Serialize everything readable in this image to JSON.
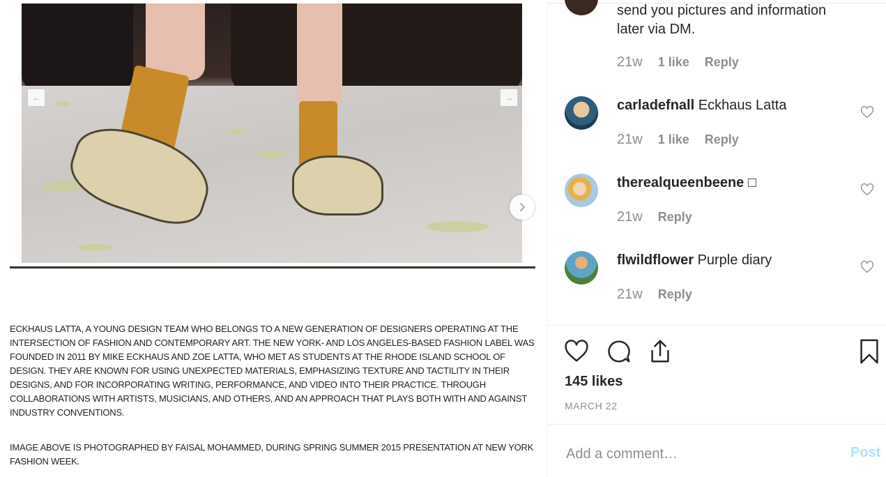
{
  "post": {
    "caption_paragraph_1": "ECKHAUS LATTA, A YOUNG DESIGN TEAM WHO BELONGS TO A NEW GENERATION OF DESIGNERS OPERATING AT THE INTERSECTION OF FASHION AND CONTEMPORARY ART. THE NEW YORK- AND LOS ANGELES-BASED FASHION LABEL WAS FOUNDED IN 2011 BY MIKE ECKHAUS AND ZOE LATTA, WHO MET AS STUDENTS AT THE RHODE ISLAND SCHOOL OF DESIGN. THEY ARE KNOWN FOR USING UNEXPECTED MATERIALS, EMPHASIZING TEXTURE AND TACTILITY IN THEIR DESIGNS, AND FOR INCORPORATING WRITING, PERFORMANCE, AND VIDEO INTO THEIR PRACTICE. THROUGH COLLABORATIONS WITH ARTISTS, MUSICIANS, AND OTHERS, AND AN APPROACH THAT PLAYS BOTH WITH AND AGAINST INDUSTRY CONVENTIONS.",
    "caption_paragraph_2": "IMAGE ABOVE IS PHOTOGRAPHED BY FAISAL MOHAMMED, DURING SPRING SUMMER 2015 PRESENTATION AT NEW YORK FASHION WEEK.",
    "inner_prev_arrow": "←",
    "inner_next_arrow": "→"
  },
  "comments": [
    {
      "user": "",
      "text": "send you pictures and information later via DM.",
      "time": "21w",
      "likes": "1 like",
      "reply": "Reply"
    },
    {
      "user": "carladefnall",
      "text": "Eckhaus Latta",
      "time": "21w",
      "likes": "1 like",
      "reply": "Reply"
    },
    {
      "user": "therealqueenbeene",
      "text": "□",
      "time": "21w",
      "likes": "",
      "reply": "Reply"
    },
    {
      "user": "flwildflower",
      "text": "Purple diary",
      "time": "21w",
      "likes": "",
      "reply": "Reply"
    }
  ],
  "actions": {
    "icons": [
      "heart-icon",
      "comment-icon",
      "share-icon",
      "bookmark-icon"
    ],
    "likes": "145 likes",
    "date": "MARCH 22"
  },
  "add_comment": {
    "placeholder": "Add a comment…",
    "post_label": "Post"
  },
  "colors": {
    "text": "#262626",
    "muted": "#8e8e8e",
    "post_disabled": "#b2dffc",
    "border": "#efefef"
  }
}
